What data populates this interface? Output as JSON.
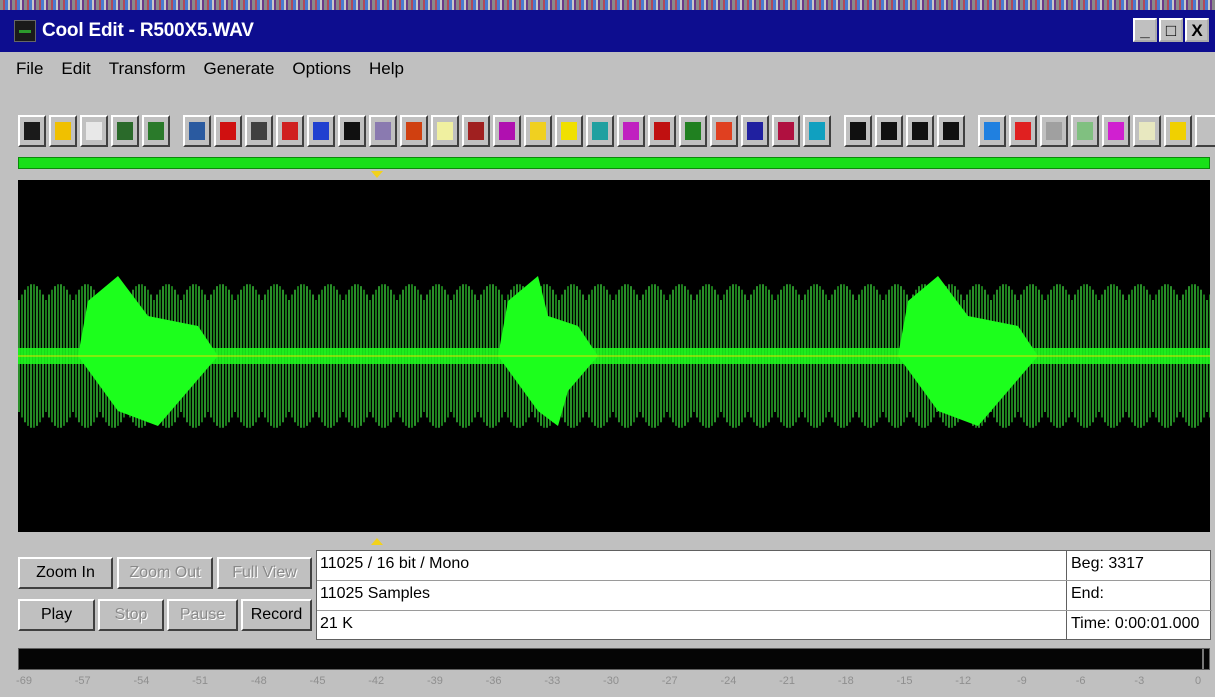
{
  "window": {
    "title": "Cool Edit - R500X5.WAV",
    "minimize_label": "_",
    "maximize_label": "□",
    "close_label": "X"
  },
  "menu": [
    {
      "label": "File"
    },
    {
      "label": "Edit"
    },
    {
      "label": "Transform"
    },
    {
      "label": "Generate"
    },
    {
      "label": "Options"
    },
    {
      "label": "Help"
    }
  ],
  "toolbar": {
    "icons": [
      "new-file-icon",
      "open-file-icon",
      "save-file-icon",
      "cut-icon",
      "copy-icon",
      "paste-icon",
      "rewind-icon",
      "stop-icon",
      "reverse-icon",
      "note-icon",
      "dot-icon",
      "noise-icon",
      "import-icon",
      "timer-icon",
      "spectrum-icon",
      "radio-icon",
      "filter-icon",
      "amplify-icon",
      "wave-icon",
      "marker-icon",
      "distort-icon",
      "grid-icon",
      "eq-icon",
      "envelope-icon",
      "compress-icon",
      "flange-icon",
      "effect-1-icon",
      "effect-2-icon",
      "effect-3-icon",
      "effect-4-icon",
      "loop-icon",
      "mixer-icon",
      "analyze-icon",
      "frequency-icon",
      "text-cursor-icon",
      "notes-icon",
      "help-icon",
      "cd-icon"
    ]
  },
  "colors": {
    "title_bar": "#0d0d8f",
    "waveform_dark": "#1a7a1a",
    "waveform_bright": "#1cff1c",
    "center_line": "#e6dc00",
    "background": "#000000"
  },
  "controls": {
    "zoom_in": "Zoom In",
    "zoom_out": "Zoom Out",
    "full_view": "Full View",
    "play": "Play",
    "stop": "Stop",
    "pause": "Pause",
    "record": "Record"
  },
  "info": {
    "format": "11025 / 16 bit / Mono",
    "samples": "11025 Samples",
    "size": "21 K",
    "begin": "Beg: 3317",
    "end": "End:",
    "time": "Time: 0:00:01.000"
  },
  "level_meter": {
    "scale": [
      "-69",
      "-57",
      "-54",
      "-51",
      "-48",
      "-45",
      "-42",
      "-39",
      "-36",
      "-33",
      "-30",
      "-27",
      "-24",
      "-21",
      "-18",
      "-15",
      "-12",
      "-9",
      "-6",
      "-3",
      "0"
    ]
  }
}
